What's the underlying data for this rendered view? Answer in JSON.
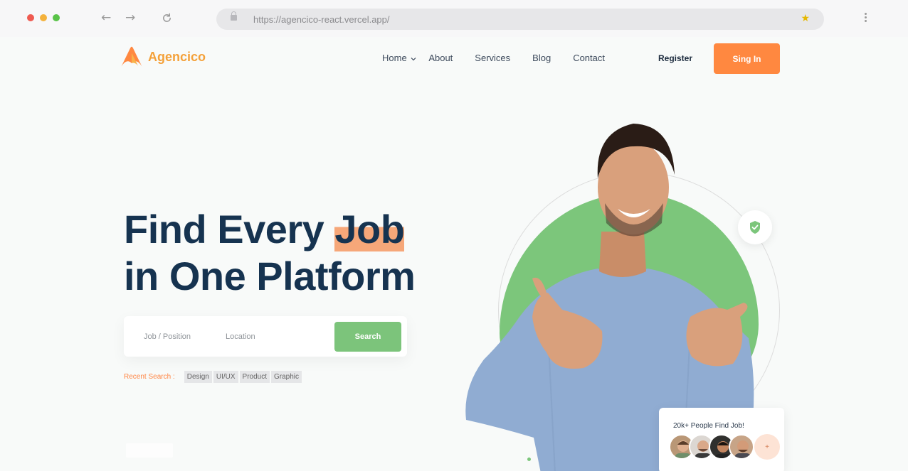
{
  "browser": {
    "url": "https://agencico-react.vercel.app/",
    "dot_colors": [
      "#ef5a50",
      "#f4b23c",
      "#59c348"
    ]
  },
  "header": {
    "logo": "Agencico",
    "nav": [
      "Home",
      "About",
      "Services",
      "Blog",
      "Contact"
    ],
    "register": "Register",
    "signin": "Sing In"
  },
  "hero": {
    "title_part1": "Find Every ",
    "title_highlight": "Job",
    "title_line2": "in One Platform"
  },
  "search": {
    "job_placeholder": "Job / Position",
    "location_placeholder": "Location",
    "button": "Search"
  },
  "recent": {
    "label": "Recent Search :",
    "tags": [
      "Design",
      "UI/UX",
      "Product",
      "Graphic"
    ]
  },
  "stats": {
    "text": "20k+ People Find Job!",
    "plus": "+"
  },
  "colors": {
    "accent_orange": "#ff8840",
    "brand_green": "#7cc47b",
    "heading_navy": "#163350"
  }
}
